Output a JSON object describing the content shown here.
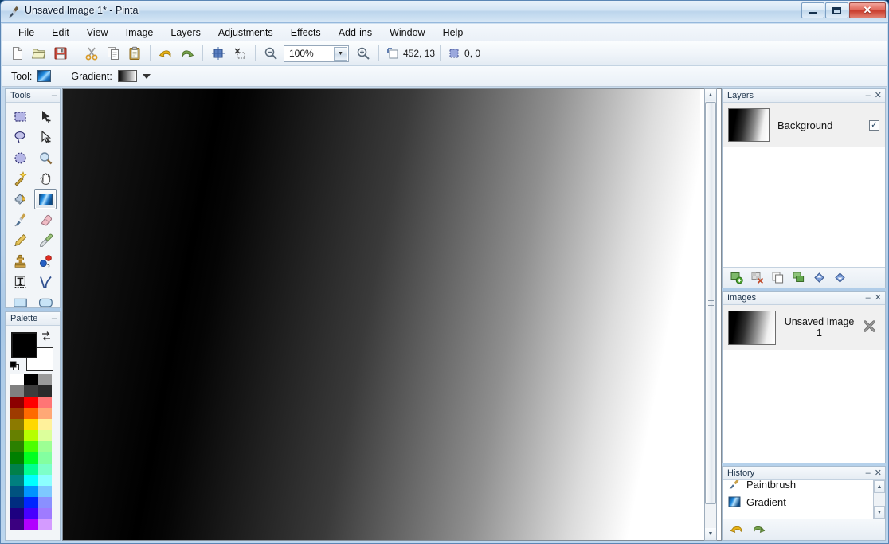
{
  "window": {
    "title": "Unsaved Image 1* - Pinta",
    "icon": "paintbrush-icon",
    "controls": {
      "minimize": "Minimize",
      "maximize": "Maximize",
      "close": "Close",
      "close_glyph": "✕"
    }
  },
  "menubar": {
    "items": [
      {
        "label": "File",
        "mnemonic": "F"
      },
      {
        "label": "Edit",
        "mnemonic": "E"
      },
      {
        "label": "View",
        "mnemonic": "V"
      },
      {
        "label": "Image",
        "mnemonic": "I"
      },
      {
        "label": "Layers",
        "mnemonic": "L"
      },
      {
        "label": "Adjustments",
        "mnemonic": "A"
      },
      {
        "label": "Effects",
        "mnemonic": "c"
      },
      {
        "label": "Add-ins",
        "mnemonic": "d"
      },
      {
        "label": "Window",
        "mnemonic": "W"
      },
      {
        "label": "Help",
        "mnemonic": "H"
      }
    ]
  },
  "toolbar": {
    "buttons": [
      {
        "name": "new-icon",
        "label": "New"
      },
      {
        "name": "open-icon",
        "label": "Open"
      },
      {
        "name": "save-icon",
        "label": "Save"
      },
      {
        "name": "cut-icon",
        "label": "Cut"
      },
      {
        "name": "copy-icon",
        "label": "Copy"
      },
      {
        "name": "paste-icon",
        "label": "Paste"
      },
      {
        "name": "undo-icon",
        "label": "Undo"
      },
      {
        "name": "redo-icon",
        "label": "Redo"
      },
      {
        "name": "crop-to-selection-icon",
        "label": "Crop to Selection"
      },
      {
        "name": "deselect-icon",
        "label": "Deselect All"
      }
    ],
    "zoom_out_label": "Zoom Out",
    "zoom_value": "100%",
    "zoom_in_label": "Zoom In",
    "cursor_position": "452, 13",
    "selection_size": "0, 0"
  },
  "tool_options": {
    "tool_label": "Tool:",
    "tool_value": "Gradient",
    "gradient_label": "Gradient:",
    "gradient_value": "Black to White"
  },
  "tools_panel": {
    "title": "Tools",
    "minimize_glyph": "‒",
    "selected": "gradient",
    "items": [
      {
        "id": "rectangle-select",
        "label": "Rectangle Select"
      },
      {
        "id": "move-selected",
        "label": "Move Selected"
      },
      {
        "id": "lasso-select",
        "label": "Lasso Select"
      },
      {
        "id": "move-selection",
        "label": "Move Selection"
      },
      {
        "id": "ellipse-select",
        "label": "Ellipse Select"
      },
      {
        "id": "zoom",
        "label": "Zoom"
      },
      {
        "id": "magic-wand",
        "label": "Magic Wand Select"
      },
      {
        "id": "pan",
        "label": "Pan"
      },
      {
        "id": "paint-bucket",
        "label": "Paint Bucket"
      },
      {
        "id": "gradient",
        "label": "Gradient"
      },
      {
        "id": "paintbrush",
        "label": "Paintbrush"
      },
      {
        "id": "eraser",
        "label": "Eraser"
      },
      {
        "id": "pencil",
        "label": "Pencil"
      },
      {
        "id": "color-picker",
        "label": "Color Picker"
      },
      {
        "id": "clone-stamp",
        "label": "Clone Stamp"
      },
      {
        "id": "recolor",
        "label": "Recolor"
      },
      {
        "id": "text",
        "label": "Text"
      },
      {
        "id": "line-curve",
        "label": "Line/Curve"
      },
      {
        "id": "rectangle",
        "label": "Rectangle"
      },
      {
        "id": "rounded-rectangle",
        "label": "Rounded Rectangle"
      }
    ]
  },
  "palette_panel": {
    "title": "Palette",
    "minimize_glyph": "‒",
    "primary_color": "#000000",
    "secondary_color": "#ffffff",
    "swap_label": "Swap Colors",
    "reset_label": "Reset Colors",
    "swatches": [
      "#ffffff",
      "#000000",
      "#9a9a9a",
      "#808080",
      "#3c3c3c",
      "#2b2b2b",
      "#8c0000",
      "#ff0000",
      "#ff7575",
      "#9e3b00",
      "#ff6a00",
      "#ffa876",
      "#8c7a00",
      "#ffd800",
      "#fff19b",
      "#668000",
      "#b6ff00",
      "#dcff9b",
      "#2b8000",
      "#4cff00",
      "#9dff94",
      "#008000",
      "#00ff21",
      "#83ffa0",
      "#00804a",
      "#00ff90",
      "#7dffc9",
      "#007f7f",
      "#00ffff",
      "#8cffff",
      "#00527f",
      "#0094ff",
      "#7ec8ff",
      "#002d80",
      "#0026ff",
      "#8a90ff",
      "#1d0080",
      "#4800ff",
      "#9f7bff",
      "#3b0080",
      "#b200ff",
      "#d49bff"
    ]
  },
  "canvas": {
    "name": "image-canvas",
    "gradient_type": "linear-black-to-white",
    "scrollbar": {
      "up": "▲",
      "down": "▼"
    }
  },
  "layers_panel": {
    "title": "Layers",
    "minimize_glyph": "‒",
    "close_glyph": "✕",
    "layers": [
      {
        "name": "Background",
        "visible": true,
        "check_glyph": "✓"
      }
    ],
    "tools": [
      {
        "name": "add-layer-icon",
        "label": "Add Layer"
      },
      {
        "name": "delete-layer-icon",
        "label": "Delete Layer"
      },
      {
        "name": "duplicate-layer-icon",
        "label": "Duplicate Layer"
      },
      {
        "name": "merge-layer-down-icon",
        "label": "Merge Layer Down"
      },
      {
        "name": "move-layer-up-icon",
        "label": "Move Layer Up"
      },
      {
        "name": "move-layer-down-icon",
        "label": "Move Layer Down"
      }
    ]
  },
  "images_panel": {
    "title": "Images",
    "minimize_glyph": "‒",
    "close_glyph": "✕",
    "items": [
      {
        "name": "Unsaved Image 1",
        "close_glyph": "✖"
      }
    ]
  },
  "history_panel": {
    "title": "History",
    "minimize_glyph": "‒",
    "close_glyph": "✕",
    "items": [
      {
        "label": "Paintbrush",
        "icon": "paintbrush-icon"
      },
      {
        "label": "Gradient",
        "icon": "gradient-icon"
      }
    ],
    "scroll": {
      "up": "▲",
      "down": "▼"
    },
    "tools": [
      {
        "name": "undo-history-icon",
        "label": "Undo"
      },
      {
        "name": "redo-history-icon",
        "label": "Redo"
      }
    ]
  }
}
